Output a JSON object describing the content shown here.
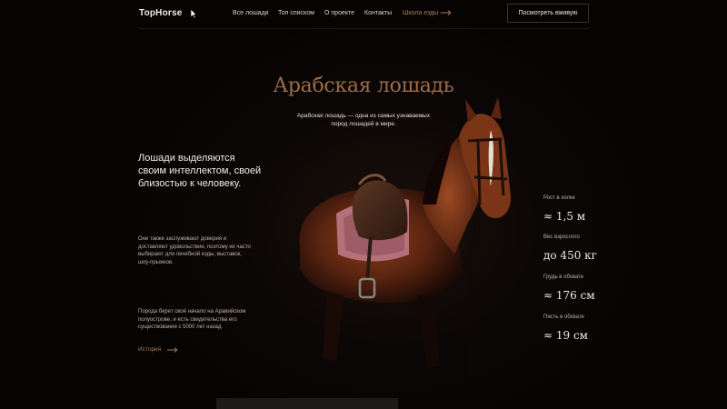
{
  "header": {
    "logo": "TopHorse",
    "nav": [
      "Все лошади",
      "Топ списком",
      "О проекте",
      "Контакты",
      "Школа езды"
    ],
    "cta_label": "Посмотреть вживую"
  },
  "hero": {
    "title": "Арабская лошадь",
    "subtitle": "Арабская лошадь — одна из самых узнаваемых пород лошадей в мире."
  },
  "left": {
    "lead": "Лошади выделяются своим интеллектом, своей близостью к человеку.",
    "para1": "Они также заслуживают доверия и доставляют удовольствие, поэтому их часто выбирают для лечебной езды, выставок, шоу-прыжков.",
    "para2": "Порода берет своё начало на Аравийском полуострове, и есть свидетельства его существования с 5000 лет назад.",
    "history_link": "История"
  },
  "stats": [
    {
      "label": "Рост в холке",
      "value": "≈ 1,5 м"
    },
    {
      "label": "Вес взрослого",
      "value": "до 450 кг"
    },
    {
      "label": "Грудь в обхвате",
      "value": "≈ 176 см"
    },
    {
      "label": "Пясть в обхвате",
      "value": "≈ 19 см"
    }
  ],
  "colors": {
    "background": "#060403",
    "accent": "#a06c46",
    "text": "#f1ebe4"
  },
  "icons": [
    "mouse-cursor-icon",
    "arrow-right-icon",
    "horse-image"
  ]
}
